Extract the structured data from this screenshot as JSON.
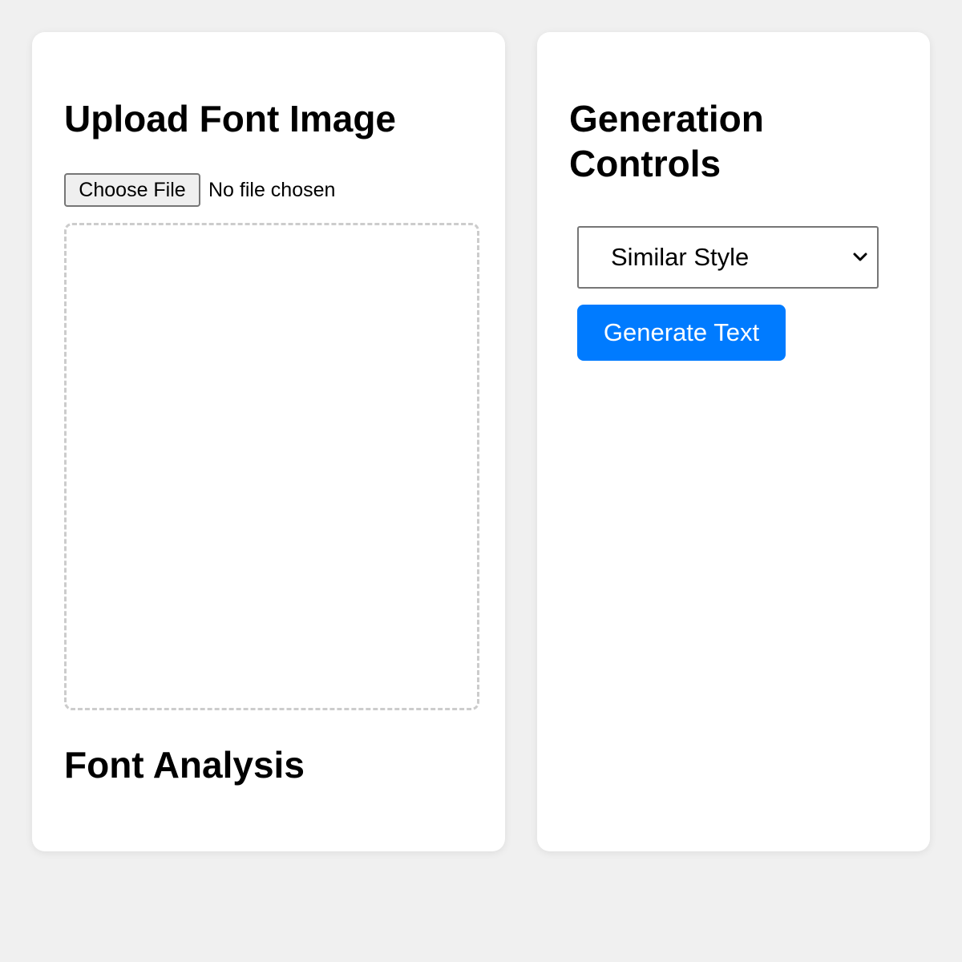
{
  "upload_panel": {
    "title": "Upload Font Image",
    "file_input": {
      "button_label": "Choose File",
      "status": "No file chosen"
    },
    "preview_area": {},
    "analysis_title": "Font Analysis"
  },
  "controls_panel": {
    "title": "Generation Controls",
    "style_select": {
      "selected": "Similar Style"
    },
    "generate_button_label": "Generate Text"
  },
  "colors": {
    "background": "#f0f0f0",
    "panel": "#ffffff",
    "accent": "#007bff",
    "dashed_border": "#cccccc"
  },
  "icons": {
    "select_indicator": "chevron-down-icon"
  }
}
